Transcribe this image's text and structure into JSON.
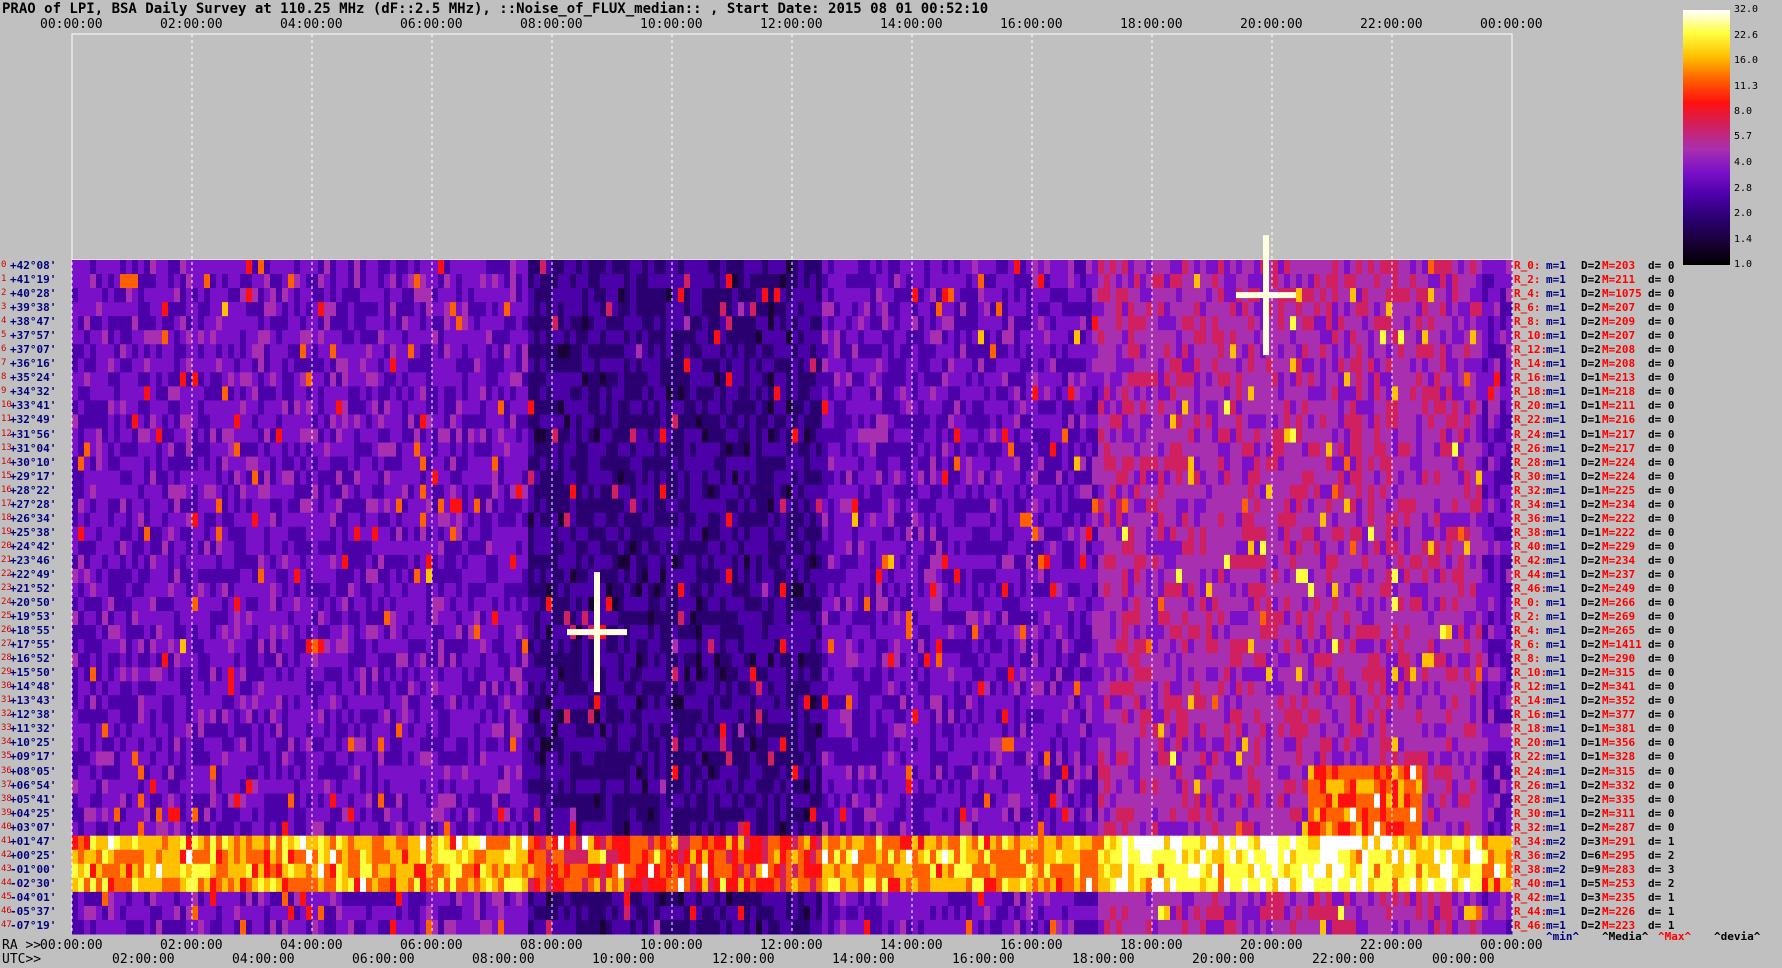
{
  "title": "PRAO of LPI, BSA Daily Survey at 110.25 MHz (dF::2.5 MHz), ::Noise_of_FLUX_median:: , Start Date: 2015 08 01 00:52:10",
  "colors": {
    "background": "#c0c0c0",
    "grid": "#ffffff",
    "dec_label": "#000080",
    "stat_r": "#ff0000",
    "stat_m": "#000080",
    "stat_D": "#000000",
    "stat_M": "#ff0000"
  },
  "chart_data": {
    "type": "heatmap",
    "colormap": "gnuplot-like (black-purple-red-yellow-white)",
    "grid": true,
    "top_axis_ticks": [
      "00:00:00",
      "02:00:00",
      "04:00:00",
      "06:00:00",
      "08:00:00",
      "10:00:00",
      "12:00:00",
      "14:00:00",
      "16:00:00",
      "18:00:00",
      "20:00:00",
      "22:00:00",
      "00:00:00"
    ],
    "ra_axis": {
      "label": "RA >>",
      "ticks": [
        "00:00:00",
        "02:00:00",
        "04:00:00",
        "06:00:00",
        "08:00:00",
        "10:00:00",
        "12:00:00",
        "14:00:00",
        "16:00:00",
        "18:00:00",
        "20:00:00",
        "22:00:00",
        "00:00:00"
      ]
    },
    "utc_axis": {
      "label": "UTC>>",
      "ticks": [
        "02:00:00",
        "04:00:00",
        "06:00:00",
        "08:00:00",
        "10:00:00",
        "12:00:00",
        "14:00:00",
        "16:00:00",
        "18:00:00",
        "20:00:00",
        "22:00:00",
        "00:00:00"
      ]
    },
    "declination_labels": [
      "+42°08'",
      "+41°19'",
      "+40°28'",
      "+39°38'",
      "+38°47'",
      "+37°57'",
      "+37°07'",
      "+36°16'",
      "+35°24'",
      "+34°32'",
      "+33°41'",
      "+32°49'",
      "+31°56'",
      "+31°04'",
      "+30°10'",
      "+29°17'",
      "+28°22'",
      "+27°28'",
      "+26°34'",
      "+25°38'",
      "+24°42'",
      "+23°46'",
      "+22°49'",
      "+21°52'",
      "+20°50'",
      "+19°53'",
      "+18°55'",
      "+17°55'",
      "+16°52'",
      "+15°50'",
      "+14°48'",
      "+13°43'",
      "+12°38'",
      "+11°32'",
      "+10°25'",
      "+09°17'",
      "+08°05'",
      "+06°54'",
      "+05°41'",
      "+04°25'",
      "+03°07'",
      "+01°47'",
      "+00°25'",
      "-01°00'",
      "-02°30'",
      "-04°01'",
      "-05°37'",
      "-07°19'"
    ],
    "beam_index_labels": [
      "0",
      "1",
      "2",
      "3",
      "4",
      "5",
      "6",
      "7",
      "8",
      "9",
      "10",
      "11",
      "12",
      "13",
      "14",
      "15",
      "16",
      "17",
      "18",
      "19",
      "20",
      "21",
      "22",
      "23",
      "24",
      "25",
      "26",
      "27",
      "28",
      "29",
      "30",
      "31",
      "32",
      "33",
      "34",
      "35",
      "36",
      "37",
      "38",
      "39",
      "40",
      "41",
      "42",
      "43",
      "44",
      "45",
      "46",
      "47"
    ],
    "stats_rows": [
      {
        "r": "R_0:",
        "m": "m=1",
        "d": "D=2",
        "M": "M=203",
        "z": "d= 0"
      },
      {
        "r": "R_2:",
        "m": "m=1",
        "d": "D=2",
        "M": "M=211",
        "z": "d= 0"
      },
      {
        "r": "R_4:",
        "m": "m=1",
        "d": "D=2",
        "M": "M=1075",
        "z": "d= 0"
      },
      {
        "r": "R_6:",
        "m": "m=1",
        "d": "D=2",
        "M": "M=207",
        "z": "d= 0"
      },
      {
        "r": "R_8:",
        "m": "m=1",
        "d": "D=2",
        "M": "M=209",
        "z": "d= 0"
      },
      {
        "r": "R_10:",
        "m": "m=1",
        "d": "D=2",
        "M": "M=207",
        "z": "d= 0"
      },
      {
        "r": "R_12:",
        "m": "m=1",
        "d": "D=2",
        "M": "M=208",
        "z": "d= 0"
      },
      {
        "r": "R_14:",
        "m": "m=1",
        "d": "D=2",
        "M": "M=208",
        "z": "d= 0"
      },
      {
        "r": "R_16:",
        "m": "m=1",
        "d": "D=1",
        "M": "M=213",
        "z": "d= 0"
      },
      {
        "r": "R_18:",
        "m": "m=1",
        "d": "D=1",
        "M": "M=218",
        "z": "d= 0"
      },
      {
        "r": "R_20:",
        "m": "m=1",
        "d": "D=1",
        "M": "M=211",
        "z": "d= 0"
      },
      {
        "r": "R_22:",
        "m": "m=1",
        "d": "D=1",
        "M": "M=216",
        "z": "d= 0"
      },
      {
        "r": "R_24:",
        "m": "m=1",
        "d": "D=1",
        "M": "M=217",
        "z": "d= 0"
      },
      {
        "r": "R_26:",
        "m": "m=1",
        "d": "D=2",
        "M": "M=217",
        "z": "d= 0"
      },
      {
        "r": "R_28:",
        "m": "m=1",
        "d": "D=2",
        "M": "M=224",
        "z": "d= 0"
      },
      {
        "r": "R_30:",
        "m": "m=1",
        "d": "D=2",
        "M": "M=224",
        "z": "d= 0"
      },
      {
        "r": "R_32:",
        "m": "m=1",
        "d": "D=1",
        "M": "M=225",
        "z": "d= 0"
      },
      {
        "r": "R_34:",
        "m": "m=1",
        "d": "D=2",
        "M": "M=234",
        "z": "d= 0"
      },
      {
        "r": "R_36:",
        "m": "m=1",
        "d": "D=2",
        "M": "M=222",
        "z": "d= 0"
      },
      {
        "r": "R_38:",
        "m": "m=1",
        "d": "D=1",
        "M": "M=222",
        "z": "d= 0"
      },
      {
        "r": "R_40:",
        "m": "m=1",
        "d": "D=2",
        "M": "M=229",
        "z": "d= 0"
      },
      {
        "r": "R_42:",
        "m": "m=1",
        "d": "D=2",
        "M": "M=234",
        "z": "d= 0"
      },
      {
        "r": "R_44:",
        "m": "m=1",
        "d": "D=2",
        "M": "M=237",
        "z": "d= 0"
      },
      {
        "r": "R_46:",
        "m": "m=1",
        "d": "D=2",
        "M": "M=249",
        "z": "d= 0"
      },
      {
        "r": "R_0:",
        "m": "m=1",
        "d": "D=2",
        "M": "M=266",
        "z": "d= 0"
      },
      {
        "r": "R_2:",
        "m": "m=1",
        "d": "D=2",
        "M": "M=269",
        "z": "d= 0"
      },
      {
        "r": "R_4:",
        "m": "m=1",
        "d": "D=2",
        "M": "M=265",
        "z": "d= 0"
      },
      {
        "r": "R_6:",
        "m": "m=1",
        "d": "D=2",
        "M": "M=1411",
        "z": "d= 0"
      },
      {
        "r": "R_8:",
        "m": "m=1",
        "d": "D=2",
        "M": "M=290",
        "z": "d= 0"
      },
      {
        "r": "R_10:",
        "m": "m=1",
        "d": "D=2",
        "M": "M=315",
        "z": "d= 0"
      },
      {
        "r": "R_12:",
        "m": "m=1",
        "d": "D=2",
        "M": "M=341",
        "z": "d= 0"
      },
      {
        "r": "R_14:",
        "m": "m=1",
        "d": "D=2",
        "M": "M=352",
        "z": "d= 0"
      },
      {
        "r": "R_16:",
        "m": "m=1",
        "d": "D=2",
        "M": "M=377",
        "z": "d= 0"
      },
      {
        "r": "R_18:",
        "m": "m=1",
        "d": "D=1",
        "M": "M=381",
        "z": "d= 0"
      },
      {
        "r": "R_20:",
        "m": "m=1",
        "d": "D=1",
        "M": "M=356",
        "z": "d= 0"
      },
      {
        "r": "R_22:",
        "m": "m=1",
        "d": "D=1",
        "M": "M=328",
        "z": "d= 0"
      },
      {
        "r": "R_24:",
        "m": "m=1",
        "d": "D=2",
        "M": "M=315",
        "z": "d= 0"
      },
      {
        "r": "R_26:",
        "m": "m=1",
        "d": "D=2",
        "M": "M=332",
        "z": "d= 0"
      },
      {
        "r": "R_28:",
        "m": "m=1",
        "d": "D=2",
        "M": "M=335",
        "z": "d= 0"
      },
      {
        "r": "R_30:",
        "m": "m=1",
        "d": "D=2",
        "M": "M=311",
        "z": "d= 0"
      },
      {
        "r": "R_32:",
        "m": "m=1",
        "d": "D=2",
        "M": "M=287",
        "z": "d= 0"
      },
      {
        "r": "R_34:",
        "m": "m=2",
        "d": "D=3",
        "M": "M=291",
        "z": "d= 1"
      },
      {
        "r": "R_36:",
        "m": "m=2",
        "d": "D=6",
        "M": "M=295",
        "z": "d= 2"
      },
      {
        "r": "R_38:",
        "m": "m=2",
        "d": "D=9",
        "M": "M=283",
        "z": "d= 3"
      },
      {
        "r": "R_40:",
        "m": "m=1",
        "d": "D=5",
        "M": "M=253",
        "z": "d= 2"
      },
      {
        "r": "R_42:",
        "m": "m=1",
        "d": "D=3",
        "M": "M=235",
        "z": "d= 1"
      },
      {
        "r": "R_44:",
        "m": "m=1",
        "d": "D=2",
        "M": "M=226",
        "z": "d= 1"
      },
      {
        "r": "R_46:",
        "m": "m=1",
        "d": "D=2",
        "M": "M=223",
        "z": "d= 1"
      }
    ],
    "stats_footer": [
      "^min^",
      "^Media^",
      "^Max^",
      "^devia^"
    ],
    "colorbar": {
      "ticks": [
        "32.0",
        "22.6",
        "16.0",
        "11.3",
        "8.0",
        "5.7",
        "4.0",
        "2.8",
        "2.0",
        "1.4",
        "1.0"
      ],
      "scale": "log",
      "range": [
        1.0,
        32.0
      ]
    },
    "bright_features": [
      {
        "ra_hours": 8.75,
        "dec_row": 26,
        "note": "cross-shaped bright source"
      },
      {
        "ra_hours": 19.9,
        "dec_row": 2,
        "note": "cross-shaped bright source (beam 4, M=1075)"
      }
    ]
  }
}
